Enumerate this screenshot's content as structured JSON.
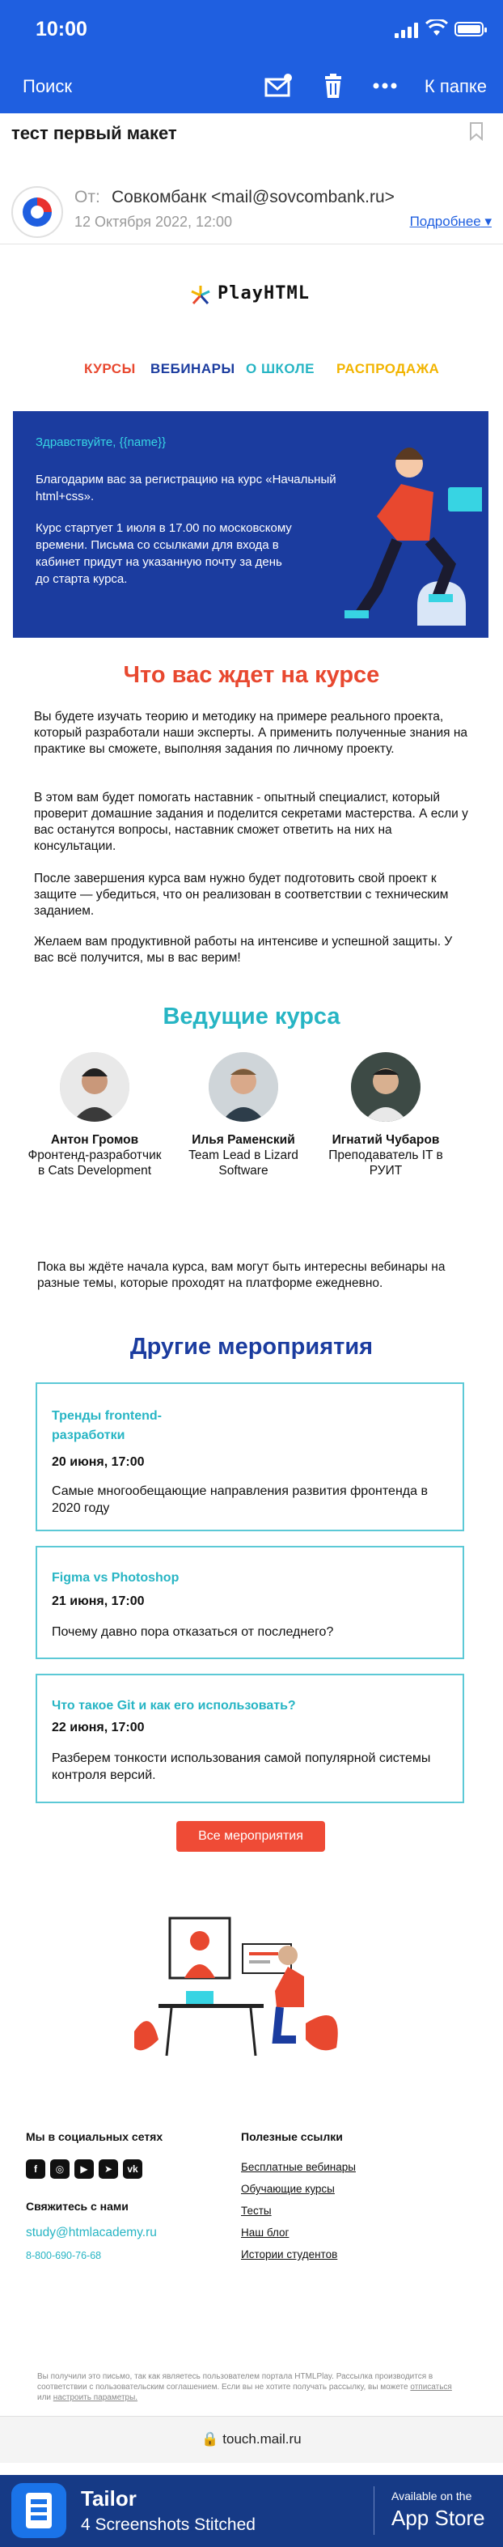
{
  "status": {
    "time": "10:00"
  },
  "nav": {
    "search": "Поиск",
    "back": "К папке"
  },
  "mail": {
    "subject": "тест первый макет",
    "from_label": "От:",
    "from": "Совкомбанк <mail@sovcombank.ru>",
    "date": "12 Октября 2022, 12:00",
    "details": "Подробнее"
  },
  "brand": {
    "logo": "PlayHTML"
  },
  "menu": [
    {
      "label": "КУРСЫ",
      "color": "#e8482f"
    },
    {
      "label": "ВЕБИНАРЫ",
      "color": "#1b3c9f"
    },
    {
      "label": "О ШКОЛЕ",
      "color": "#27b5c4"
    },
    {
      "label": "РАСПРОДАЖА",
      "color": "#f2b400"
    }
  ],
  "hero": {
    "greeting": "Здравствуйте, {{name}}",
    "p1": "Благодарим вас за регистрацию на курс «Начальный html+css».",
    "p2": "Курс стартует 1 июля в 17.00 по московскому времени. Письма со ссылками для входа в кабинет придут на указанную почту за день до старта курса."
  },
  "course": {
    "title": "Что вас ждет на курсе",
    "p1": "Вы будете изучать теорию и методику на примере реального проекта, который разработали наши эксперты. А применить полученные знания на практике вы сможете, выполняя задания по личному проекту.",
    "p2": "В этом вам будет помогать наставник - опытный специалист, который проверит домашние задания и поделится секретами мастерства. А если у вас останутся вопросы, наставник сможет ответить на них на консультации.",
    "p3": "После завершения курса вам нужно будет подготовить свой проект к защите — убедиться, что он реализован в соответствии с техническим заданием.",
    "p4": "Желаем вам продуктивной работы на интенсиве и успешной защиты. У вас всё получится, мы в вас верим!"
  },
  "teachers": {
    "title": "Ведущие курса",
    "items": [
      {
        "name": "Антон Громов",
        "role": "Фронтенд-разработчик в Cats Development"
      },
      {
        "name": "Илья Раменский",
        "role": "Team Lead в Lizard Software"
      },
      {
        "name": "Игнатий Чубаров",
        "role": "Преподаватель IT в РУИТ"
      }
    ]
  },
  "events": {
    "intro": "Пока вы ждёте начала курса, вам могут быть интересны вебинары на разные темы, которые проходят на платформе ежедневно.",
    "title": "Другие мероприятия",
    "items": [
      {
        "title": "Тренды frontend-разработки",
        "date": "20 июня, 17:00",
        "text": "Самые многообещающие направления развития фронтенда в 2020 году"
      },
      {
        "title": "Figma vs Photoshop",
        "date": "21 июня, 17:00",
        "text": "Почему давно пора отказаться от последнего?"
      },
      {
        "title": "Что такое Git и как его использовать?",
        "date": "22 июня, 17:00",
        "text": "Разберем тонкости использования самой популярной системы контроля версий."
      }
    ],
    "button": "Все мероприятия"
  },
  "footer": {
    "social_title": "Мы в социальных сетях",
    "contact_title": "Свяжитесь с нами",
    "email": "study@htmlacademy.ru",
    "phone": "8-800-690-76-68",
    "links_title": "Полезные ссылки",
    "links": [
      "Бесплатные вебинары",
      "Обучающие курсы",
      "Тесты",
      "Наш блог",
      "Истории студентов"
    ],
    "legal_1": "Вы получили это письмо, так как являетесь пользователем портала HTMLPlay. Рассылка производится в соответствии с пользовательским соглашением. Если вы не хотите получать рассылку, вы можете",
    "legal_unsub": "отписаться",
    "legal_or": "или",
    "legal_settings": "настроить параметры."
  },
  "browser": {
    "url": "touch.mail.ru"
  },
  "ad": {
    "name": "Tailor",
    "tagline": "4 Screenshots Stitched",
    "avail": "Available on the",
    "store": "App Store"
  },
  "colors": {
    "primary": "#1f5fe0",
    "hero": "#1b3c9f",
    "accent_red": "#e8482f",
    "accent_teal": "#27b5c4",
    "accent_yellow": "#f2b400"
  }
}
